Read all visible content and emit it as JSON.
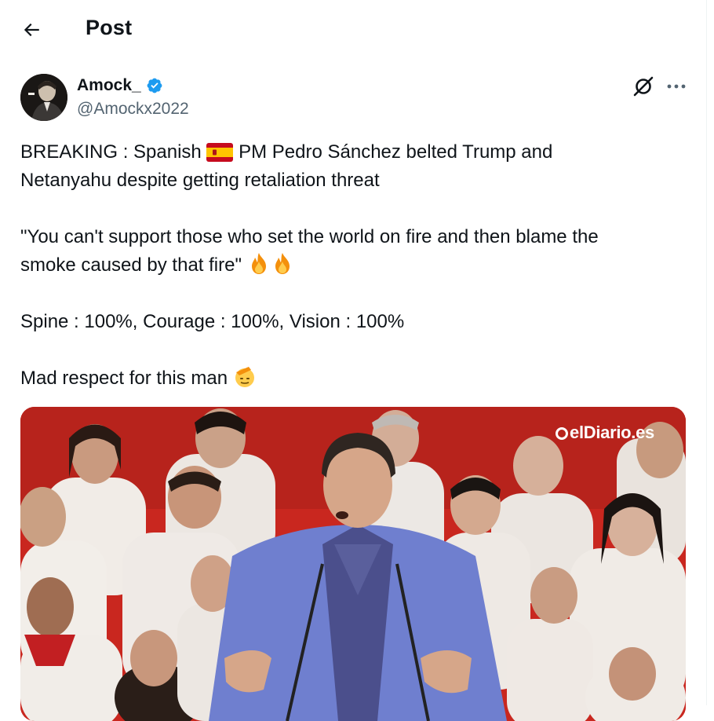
{
  "header": {
    "title": "Post"
  },
  "author": {
    "name": "Amock_",
    "handle": "@Amockx2022",
    "verified": true
  },
  "tweet": {
    "paragraphs": [
      [
        "BREAKING : Spanish ",
        "flag-es",
        " PM Pedro Sánchez belted Trump and",
        "Netanyahu despite getting retaliation threat"
      ],
      [
        "\"You can't support those who set the world on fire and then blame the",
        "smoke caused by that fire\" ",
        "fire",
        "fire"
      ],
      [
        "Spine : 100%, Courage : 100%, Vision : 100%"
      ],
      [
        "Mad respect for this man ",
        "saluting-face"
      ]
    ],
    "line1a": "BREAKING : Spanish",
    "line1b": "PM Pedro Sánchez belted Trump and",
    "line2": "Netanyahu despite getting retaliation threat",
    "line3": "\"You can't support those who set the world on fire and then blame the",
    "line4": "smoke caused by that fire\"",
    "line5": "Spine : 100%, Courage : 100%, Vision : 100%",
    "line6": "Mad respect for this man"
  },
  "media": {
    "watermark": "elDiario.es"
  },
  "colors": {
    "verified": "#1d9bf0",
    "secondary_text": "#536471",
    "media_bg": "#c9271f"
  }
}
